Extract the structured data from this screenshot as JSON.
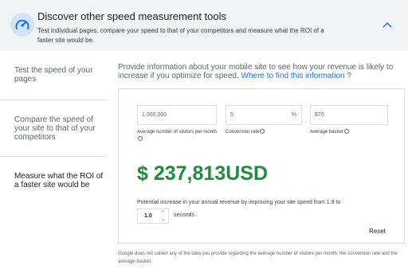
{
  "header": {
    "title": "Discover other speed measurement tools",
    "description": "Test individual pages, compare your speed to that of your competitors and measure what the ROI of a faster site would be.",
    "icon": "speedometer-icon",
    "collapse_icon": "chevron-up-icon",
    "accent_color": "#1a73e8"
  },
  "sidebar": {
    "items": [
      {
        "label": "Test the speed of your pages",
        "active": false
      },
      {
        "label": "Compare the speed of your site to that of your competitors",
        "active": false
      },
      {
        "label": "Measure what the ROI of a faster site would be",
        "active": true
      }
    ]
  },
  "main": {
    "intro_text": "Provide information about your mobile site to see how your revenue is likely to increase if you optimize for speed.",
    "intro_link": "Where to find this information ?",
    "fields": [
      {
        "value": "1,000,000",
        "unit": "",
        "label": "Average number of visitors per month"
      },
      {
        "value": "5",
        "unit": "%",
        "label": "Conversion rate"
      },
      {
        "value": "$70",
        "unit": "",
        "label": "Average basket"
      }
    ],
    "result_value": "$ 237,813USD",
    "result_color": "#1e8e3e",
    "potential_text": "Potential increase in your annual revenue by improving your site speed from 1.9 to",
    "stepper_value": "1.0",
    "seconds_label": "seconds .",
    "reset_label": "Reset"
  },
  "disclaimer": "Google does not collect any of the data you provide regarding the average number of visitors per month, the conversion rate and the average basket."
}
